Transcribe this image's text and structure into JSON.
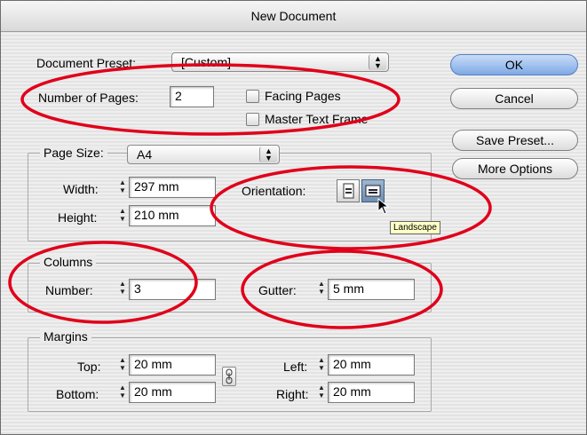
{
  "window": {
    "title": "New Document"
  },
  "preset": {
    "label": "Document Preset:",
    "value": "[Custom]"
  },
  "pages": {
    "label": "Number of Pages:",
    "value": "2"
  },
  "options": {
    "facing_pages": "Facing Pages",
    "master_text_frame": "Master Text Frame"
  },
  "page_size": {
    "group_label": "Page Size:",
    "value": "A4",
    "width_label": "Width:",
    "width_value": "297 mm",
    "height_label": "Height:",
    "height_value": "210 mm",
    "orientation_label": "Orientation:",
    "tooltip": "Landscape"
  },
  "columns": {
    "group_label": "Columns",
    "number_label": "Number:",
    "number_value": "3",
    "gutter_label": "Gutter:",
    "gutter_value": "5 mm"
  },
  "margins": {
    "group_label": "Margins",
    "top_label": "Top:",
    "top_value": "20 mm",
    "bottom_label": "Bottom:",
    "bottom_value": "20 mm",
    "left_label": "Left:",
    "left_value": "20 mm",
    "right_label": "Right:",
    "right_value": "20 mm"
  },
  "buttons": {
    "ok": "OK",
    "cancel": "Cancel",
    "save_preset": "Save Preset...",
    "more_options": "More Options"
  },
  "colors": {
    "annotation": "#e0001a",
    "default_button": "#7ea9e6"
  }
}
